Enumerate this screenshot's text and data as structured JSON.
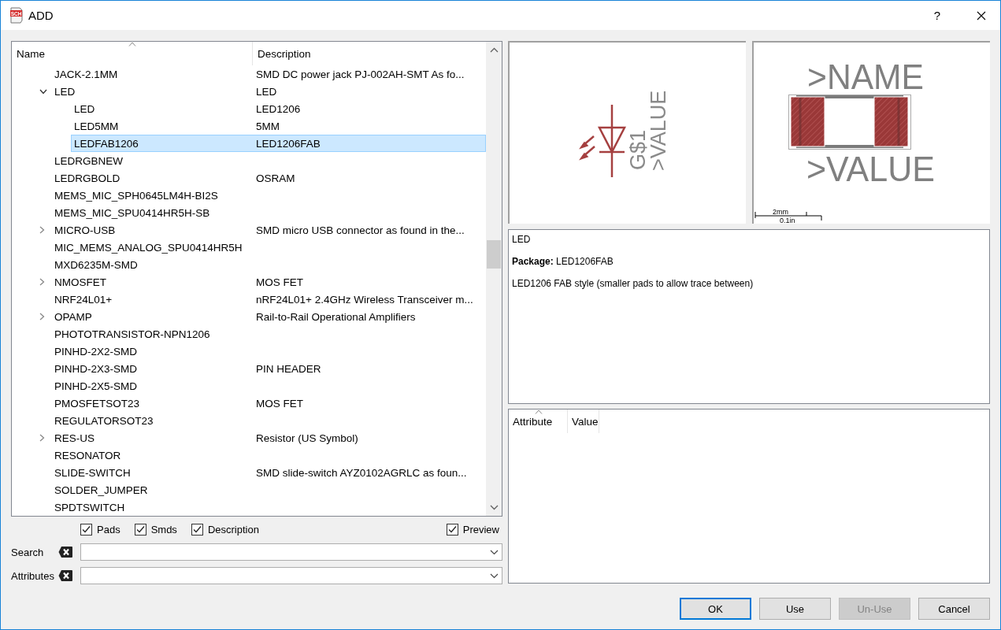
{
  "window": {
    "title": "ADD",
    "icon_label": "SCH",
    "help": "?"
  },
  "tree": {
    "columns": [
      {
        "label": "Name",
        "sorted": true
      },
      {
        "label": "Description",
        "sorted": false
      }
    ],
    "rows": [
      {
        "kind": "item",
        "name": "JACK-2.1MM",
        "description": "SMD DC power jack PJ-002AH-SMT As fo...",
        "selected": false
      },
      {
        "kind": "group",
        "name": "LED",
        "description": "LED",
        "expanded": true,
        "selected": false,
        "children": [
          {
            "kind": "item",
            "name": "LED",
            "description": "LED1206",
            "selected": false
          },
          {
            "kind": "item",
            "name": "LED5MM",
            "description": "5MM",
            "selected": false
          },
          {
            "kind": "item",
            "name": "LEDFAB1206",
            "description": "LED1206FAB",
            "selected": true
          }
        ]
      },
      {
        "kind": "item",
        "name": "LEDRGBNEW",
        "selected": false
      },
      {
        "kind": "item",
        "name": "LEDRGBOLD",
        "description": "OSRAM",
        "selected": false
      },
      {
        "kind": "item",
        "name": "MEMS_MIC_SPH0645LM4H-BI2S",
        "selected": false
      },
      {
        "kind": "item",
        "name": "MEMS_MIC_SPU0414HR5H-SB",
        "selected": false
      },
      {
        "kind": "group",
        "name": "MICRO-USB",
        "description": "SMD micro USB connector as found in the...",
        "expanded": false,
        "selected": false
      },
      {
        "kind": "item",
        "name": "MIC_MEMS_ANALOG_SPU0414HR5H",
        "selected": false
      },
      {
        "kind": "item",
        "name": "MXD6235M-SMD",
        "selected": false
      },
      {
        "kind": "group",
        "name": "NMOSFET",
        "description": "MOS FET",
        "expanded": false,
        "selected": false
      },
      {
        "kind": "item",
        "name": "NRF24L01+",
        "description": "nRF24L01+ 2.4GHz Wireless Transceiver m...",
        "selected": false
      },
      {
        "kind": "group",
        "name": "OPAMP",
        "description": "Rail-to-Rail Operational Amplifiers",
        "expanded": false,
        "selected": false
      },
      {
        "kind": "item",
        "name": "PHOTOTRANSISTOR-NPN1206",
        "selected": false
      },
      {
        "kind": "item",
        "name": "PINHD-2X2-SMD",
        "selected": false
      },
      {
        "kind": "item",
        "name": "PINHD-2X3-SMD",
        "description": "PIN HEADER",
        "selected": false
      },
      {
        "kind": "item",
        "name": "PINHD-2X5-SMD",
        "selected": false
      },
      {
        "kind": "item",
        "name": "PMOSFETSOT23",
        "description": "MOS FET",
        "selected": false
      },
      {
        "kind": "item",
        "name": "REGULATORSOT23",
        "selected": false
      },
      {
        "kind": "group",
        "name": "RES-US",
        "description": "Resistor (US Symbol)",
        "expanded": false,
        "selected": false
      },
      {
        "kind": "item",
        "name": "RESONATOR",
        "selected": false
      },
      {
        "kind": "item",
        "name": "SLIDE-SWITCH",
        "description": "SMD slide-switch AYZ0102AGRLC as foun...",
        "selected": false
      },
      {
        "kind": "item",
        "name": "SOLDER_JUMPER",
        "selected": false
      },
      {
        "kind": "item",
        "name": "SPDTSWITCH",
        "selected": false
      }
    ]
  },
  "filters": {
    "options": [
      {
        "label": "Pads",
        "checked": true
      },
      {
        "label": "Smds",
        "checked": true
      },
      {
        "label": "Description",
        "checked": true
      }
    ],
    "preview_option": {
      "label": "Preview",
      "checked": true
    },
    "search": {
      "label": "Search"
    },
    "attributes": {
      "label": "Attributes"
    }
  },
  "preview": {
    "symbol": {
      "name_label": "G$1",
      "value_label": ">VALUE"
    },
    "package": {
      "name_label": ">NAME",
      "value_label": ">VALUE",
      "scale_metric": "2mm",
      "scale_imperial": "0.1in"
    }
  },
  "description": {
    "lines": [
      "LED",
      "**Package:** LED1206FAB",
      "LED1206 FAB style (smaller pads to allow trace between)"
    ]
  },
  "attributes_table": {
    "columns": [
      {
        "label": "Attribute",
        "sorted": true
      },
      {
        "label": "Value",
        "sorted": false
      }
    ]
  },
  "buttons": [
    {
      "label": "OK",
      "default": true,
      "disabled": false
    },
    {
      "label": "Use",
      "default": false,
      "disabled": false
    },
    {
      "label": "Un-Use",
      "default": false,
      "disabled": true
    },
    {
      "label": "Cancel",
      "default": false,
      "disabled": false
    }
  ]
}
